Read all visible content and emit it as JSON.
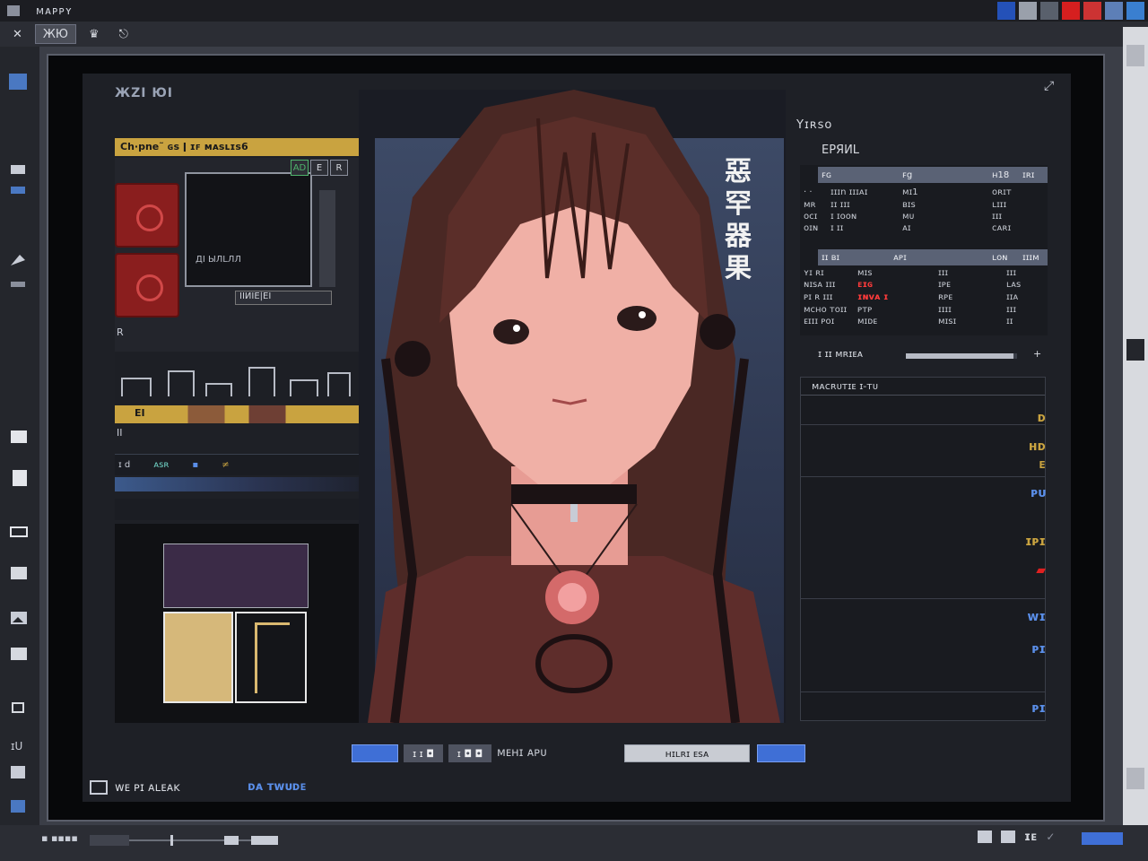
{
  "window": {
    "title": "ᴍᴀᴘᴘʏ"
  },
  "tabs": [
    {
      "label": "ЖЮ",
      "active": true
    },
    {
      "label": "♛",
      "active": false
    },
    {
      "label": "⎋",
      "active": false
    }
  ],
  "canvas": {
    "label": "ЖZI ЮI"
  },
  "left_panel": {
    "header": "Ch·pne˜ ɢꜱ ǀ ɪꜰ ᴍᴀꜱʟɪꜱ6",
    "buttons": [
      "AD",
      "E",
      "R"
    ],
    "preview_caption": "ДI ЫЛLЛЛ",
    "cells_caption": "IIИIЕ|ЕI",
    "side_text": "R",
    "gold_bar_label": "EI",
    "mini_label": "II",
    "timeline_labels": [
      "ɪ d",
      "ᴀꜱʀ",
      "▪",
      "≠"
    ]
  },
  "portrait": {
    "side_glyphs": "惡\n罕\n器\n果"
  },
  "right_panel": {
    "title": "Yɪʀꜱᴏ",
    "subtitle": "ЕРЯИL",
    "table1": {
      "headers": [
        "ꜰɢ",
        "ꜰg",
        "ʜ18",
        "ɪʀɪ"
      ],
      "rows": [
        [
          "· ·",
          "ɪɪɪn ɪɪɪᴀɪ",
          "ᴍɪ1",
          "ᴏʀɪᴛ"
        ],
        [
          "ᴍʀ",
          "ɪɪ ɪɪɪ",
          "ʙɪꜱ",
          "ʟɪɪɪ"
        ],
        [
          "ᴏᴄɪ",
          "ɪ ɪᴏᴏɴ",
          "ᴍᴜ",
          "ɪɪɪ"
        ],
        [
          "ᴏɪɴ",
          "ɪ ɪɪ",
          "ᴀɪ",
          "ᴄᴀʀɪ"
        ]
      ]
    },
    "table2": {
      "headers": [
        "ɪɪ ʙɪ",
        "ᴀᴘɪ",
        "ʟᴏɴ",
        "ɪɪɪᴍ"
      ],
      "rows": [
        [
          "ʏɪ ʀɪ",
          "ᴍɪꜱ",
          "ɪɪɪ",
          "ɪɪɪ"
        ],
        [
          "ɴɪꜱᴀ ɪɪɪ",
          "ᴇɪɢ",
          "ɪᴘᴇ",
          "ʟᴀꜱ"
        ],
        [
          "ᴘɪ ʀ ɪɪɪ",
          "ɪɴᴠᴀ ɪ",
          "ʀᴘᴇ",
          "ɪɪᴀ"
        ],
        [
          "ᴍᴄʜᴏ ᴛᴏɪɪ",
          "ᴘᴛᴘ",
          "ɪɪɪɪ",
          "ɪɪɪ"
        ],
        [
          "ᴇɪɪɪ ᴘᴏɪ",
          "ᴍɪᴅᴇ",
          "ᴍɪꜱɪ",
          "ɪɪ"
        ]
      ]
    },
    "progress": {
      "label": "ɪ  ɪɪ  ᴍʀɪᴇᴀ",
      "value": 0.97
    },
    "log": {
      "header": "ᴍᴀᴄʀᴜᴛɪᴇ ɪ-ᴛᴜ",
      "icons": [
        "ᴅ",
        "ʜᴅ",
        "ᴇ",
        "ᴘᴜ",
        "ɪᴘɪ",
        "▰",
        "ᴡɪ",
        "ᴘɪ",
        "ᴘɪ"
      ]
    }
  },
  "action_row": {
    "btn2": "ɪ ɪ ◘",
    "btn3": "ɪ ◘ ◘",
    "text": "ᴍᴇʜɪ ᴀᴘᴜ",
    "btn4": "ʜɪʟʀɪ ᴇꜱᴀ"
  },
  "footer": {
    "check_label": "ᴡᴇ  ᴘɪ ᴀʟᴇᴀᴋ",
    "link": "ᴅᴀ ᴛᴡᴜᴅᴇ"
  },
  "status": {
    "text": "▪ ▪▪▪▪",
    "right_label": "ɪᴇ"
  },
  "colors": {
    "accent": "#3f6fd6",
    "gold": "#c9a340",
    "alert": "#ff3b3b",
    "bg": "#1e2026"
  }
}
